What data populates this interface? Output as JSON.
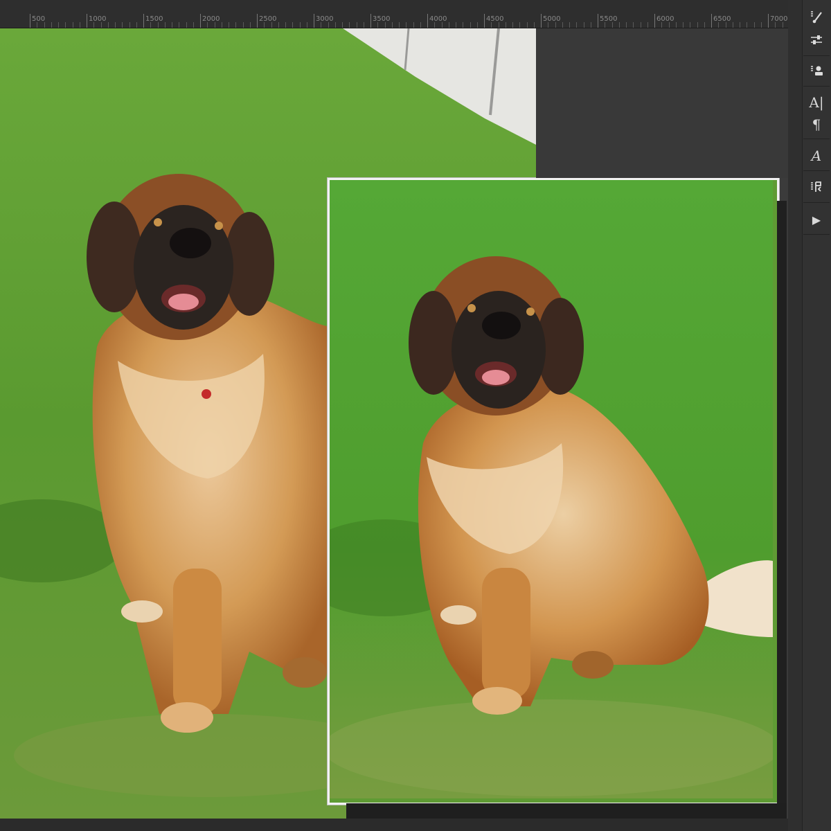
{
  "ruler": {
    "labels": [
      "500",
      "1000",
      "1500",
      "2000",
      "2500",
      "3000",
      "3500",
      "4000",
      "4500",
      "5000",
      "5500",
      "6000",
      "6500",
      "7000"
    ]
  },
  "tools": [
    {
      "name": "brush-settings-icon"
    },
    {
      "name": "adjustments-icon"
    },
    {
      "name": "clone-source-icon"
    },
    {
      "name": "character-icon",
      "glyph": "A|"
    },
    {
      "name": "paragraph-icon",
      "glyph": "¶"
    },
    {
      "name": "glyphs-icon",
      "glyph": "A"
    },
    {
      "name": "properties-icon"
    },
    {
      "name": "play-action-icon",
      "glyph": "▶"
    }
  ],
  "colors": {
    "grass": "#5c9a2f",
    "grass_dark": "#3f7a1f",
    "fur": "#c98a44",
    "fur_light": "#e9c79a",
    "face": "#2a2320",
    "frame": "#f2f2f2"
  }
}
